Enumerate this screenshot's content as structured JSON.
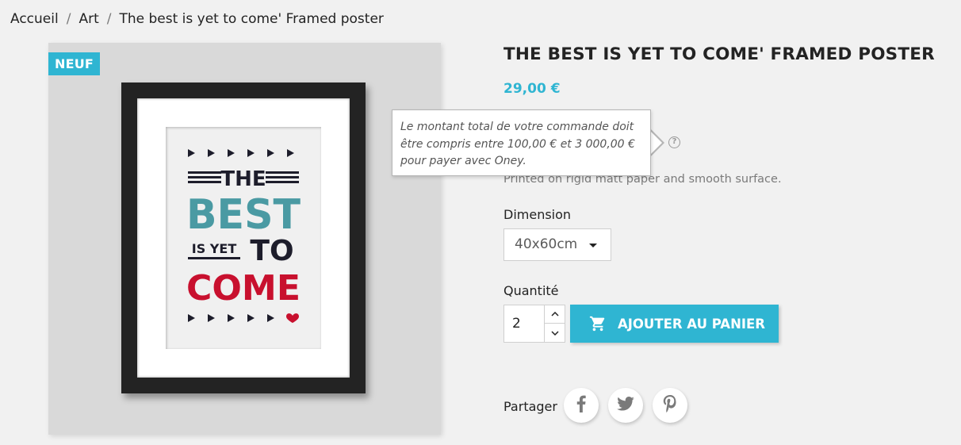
{
  "breadcrumb": {
    "items": [
      {
        "label": "Accueil"
      },
      {
        "label": "Art"
      },
      {
        "label": "The best is yet to come' Framed poster"
      }
    ],
    "separator": "/"
  },
  "product_image": {
    "badge": "NEUF",
    "poster_lines": {
      "the": "THE",
      "best": "BEST",
      "is_yet": "IS YET",
      "to": "TO",
      "come": "COME"
    }
  },
  "product": {
    "title": "THE BEST IS YET TO COME' FRAMED POSTER",
    "price": "29,00 €",
    "description": "Printed on rigid matt paper and smooth surface."
  },
  "tooltip": {
    "line1": "Le montant total de votre commande doit",
    "line2": "être compris entre 100,00 € et 3 000,00 €",
    "line3": "pour payer avec Oney."
  },
  "options": {
    "dimension_label": "Dimension",
    "dimension_value": "40x60cm",
    "quantity_label": "Quantité",
    "quantity_value": "2"
  },
  "actions": {
    "add_to_cart": "AJOUTER AU PANIER"
  },
  "share": {
    "label": "Partager",
    "networks": [
      "facebook",
      "twitter",
      "pinterest"
    ]
  },
  "colors": {
    "accent": "#2fb5d2",
    "poster_teal": "#4a9aa3",
    "poster_red": "#c8102e",
    "text": "#232323"
  },
  "icons": [
    "question-icon",
    "cart-icon",
    "chevron-up-icon",
    "chevron-down-icon",
    "caret-down-icon",
    "facebook-icon",
    "twitter-icon",
    "pinterest-icon"
  ]
}
